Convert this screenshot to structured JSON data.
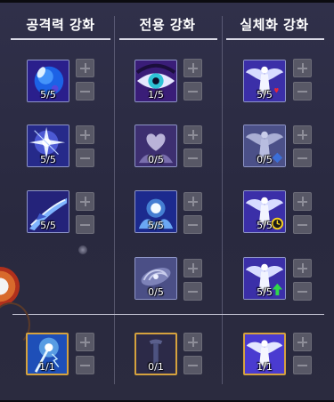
{
  "headers": {
    "attack": "공격력 강화",
    "exclusive": "전용 강화",
    "realize": "실체화 강화"
  },
  "attack": [
    {
      "icon": "blue-orb-skill-icon",
      "level": "5/5"
    },
    {
      "icon": "light-burst-skill-icon",
      "level": "5/5"
    },
    {
      "icon": "blade-slash-skill-icon",
      "level": "5/5"
    }
  ],
  "exclusive": [
    {
      "icon": "eye-skill-icon",
      "level": "1/5"
    },
    {
      "icon": "heart-hands-skill-icon",
      "level": "0/5"
    },
    {
      "icon": "glowing-orb-hands-skill-icon",
      "level": "5/5"
    },
    {
      "icon": "galaxy-swirl-skill-icon",
      "level": "0/5"
    }
  ],
  "realize": [
    {
      "icon": "winged-figure-heart-icon",
      "level": "5/5"
    },
    {
      "icon": "winged-figure-diamond-icon",
      "level": "0/5"
    },
    {
      "icon": "winged-figure-clock-icon",
      "level": "5/5"
    },
    {
      "icon": "winged-figure-arrow-icon",
      "level": "5/5"
    }
  ],
  "bottom": [
    {
      "icon": "staff-lightning-skill-icon",
      "level": "1/1"
    },
    {
      "icon": "dark-pillar-skill-icon",
      "level": "0/1"
    },
    {
      "icon": "winged-figure-skill-icon",
      "level": "1/1"
    }
  ],
  "colors": {
    "background": "#2d2d40",
    "slot_border": "#8f96c8",
    "gold_border": "#d5a23e",
    "control_button": "#585866"
  }
}
